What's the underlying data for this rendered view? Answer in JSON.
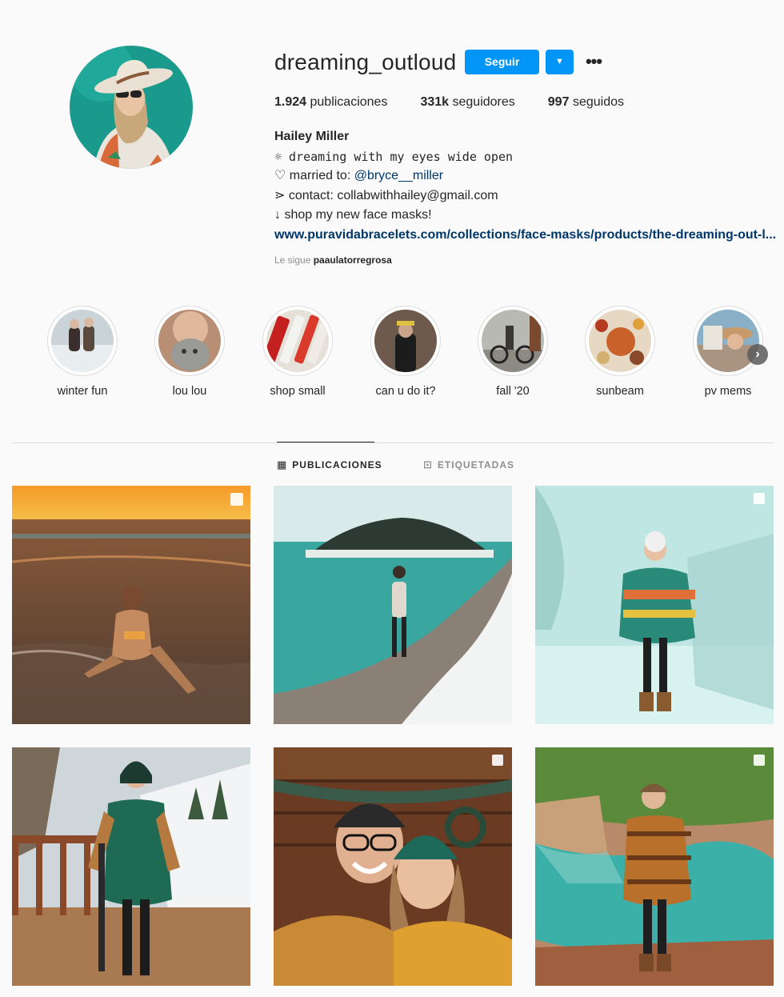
{
  "profile": {
    "username": "dreaming_outloud",
    "follow_label": "Seguir",
    "dropdown_icon": "chevron-down-icon",
    "more_icon": "more-options-icon",
    "stats": {
      "posts_count": "1.924",
      "posts_label": "publicaciones",
      "followers_count": "331k",
      "followers_label": "seguidores",
      "following_count": "997",
      "following_label": "seguidos"
    },
    "full_name": "Hailey Miller",
    "bio_line1": "☼ dreaming with my eyes wide open",
    "bio_line2_prefix": "♡ married to: ",
    "bio_line2_mention": "@bryce__miller",
    "bio_line3": "⋗ contact: collabwithhailey@gmail.com",
    "bio_line4": "↓ shop my new face masks!",
    "website": "www.puravidabracelets.com/collections/face-masks/products/the-dreaming-out-l...",
    "followed_by_prefix": "Le sigue",
    "followed_by_user": "paaulatorregrosa"
  },
  "highlights": [
    {
      "label": "winter fun"
    },
    {
      "label": "lou lou"
    },
    {
      "label": "shop small"
    },
    {
      "label": "can u do it?"
    },
    {
      "label": "fall '20"
    },
    {
      "label": "sunbeam"
    },
    {
      "label": "pv mems"
    }
  ],
  "tabs": {
    "posts_label": "PUBLICACIONES",
    "tagged_label": "ETIQUETADAS"
  },
  "colors": {
    "accent": "#0095f6",
    "link": "#00376b"
  }
}
